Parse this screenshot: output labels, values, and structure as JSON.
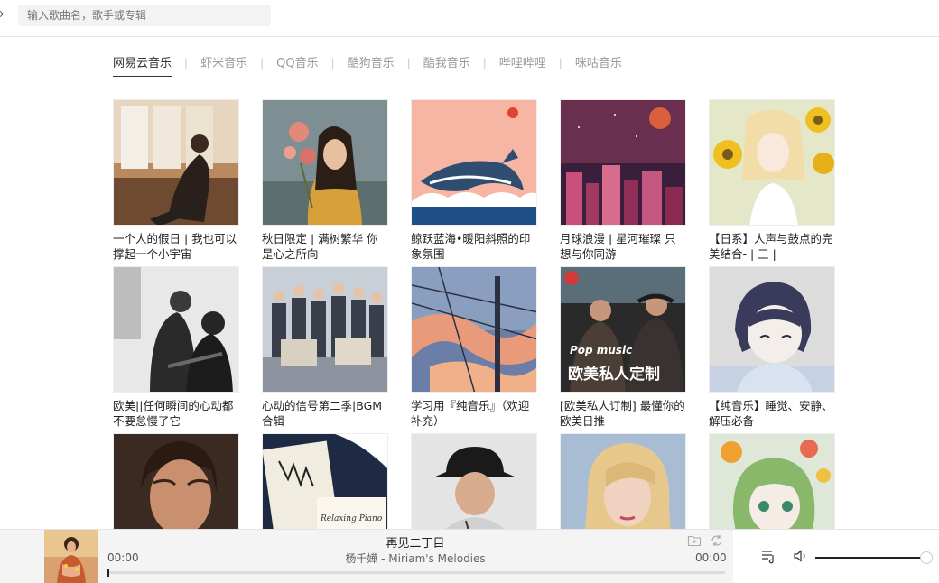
{
  "search": {
    "placeholder": "输入歌曲名，歌手或专辑"
  },
  "tabs": [
    {
      "label": "网易云音乐",
      "active": true
    },
    {
      "label": "虾米音乐",
      "active": false
    },
    {
      "label": "QQ音乐",
      "active": false
    },
    {
      "label": "酷狗音乐",
      "active": false
    },
    {
      "label": "酷我音乐",
      "active": false
    },
    {
      "label": "哔哩哔哩",
      "active": false
    },
    {
      "label": "咪咕音乐",
      "active": false
    }
  ],
  "tab_separator": "|",
  "playlists": [
    {
      "title": "一个人的假日 | 我也可以撑起一个小宇宙"
    },
    {
      "title": "秋日限定 | 满树繁华 你是心之所向"
    },
    {
      "title": "鲸跃蓝海•暖阳斜照的印象氛围"
    },
    {
      "title": "月球浪漫 | 星河璀璨 只想与你同游"
    },
    {
      "title": "【日系】人声与鼓点的完美结合- | 三 |"
    },
    {
      "title": "欧美||任何瞬间的心动都不要怠慢了它"
    },
    {
      "title": "心动的信号第二季|BGM合辑"
    },
    {
      "title": "学习用『纯音乐』（欢迎补充）"
    },
    {
      "title": "[欧美私人订制] 最懂你的欧美日推"
    },
    {
      "title": "【纯音乐】睡觉、安静、解压必备"
    },
    {
      "title": ""
    },
    {
      "title": ""
    },
    {
      "title": ""
    },
    {
      "title": ""
    },
    {
      "title": ""
    }
  ],
  "cover_texts": {
    "pop_music": "Pop music",
    "pop_cn": "欧美私人定制",
    "piano": "Relaxing Piano"
  },
  "player": {
    "song": "再见二丁目",
    "artist": "杨千嬅 - Miriam's Melodies",
    "current_time": "00:00",
    "duration": "00:00",
    "progress": 0,
    "volume": 0.97
  },
  "icons": {
    "add_to_folder": "folder-plus-icon",
    "loop": "loop-icon",
    "playlist": "playlist-icon",
    "volume": "volume-icon"
  }
}
